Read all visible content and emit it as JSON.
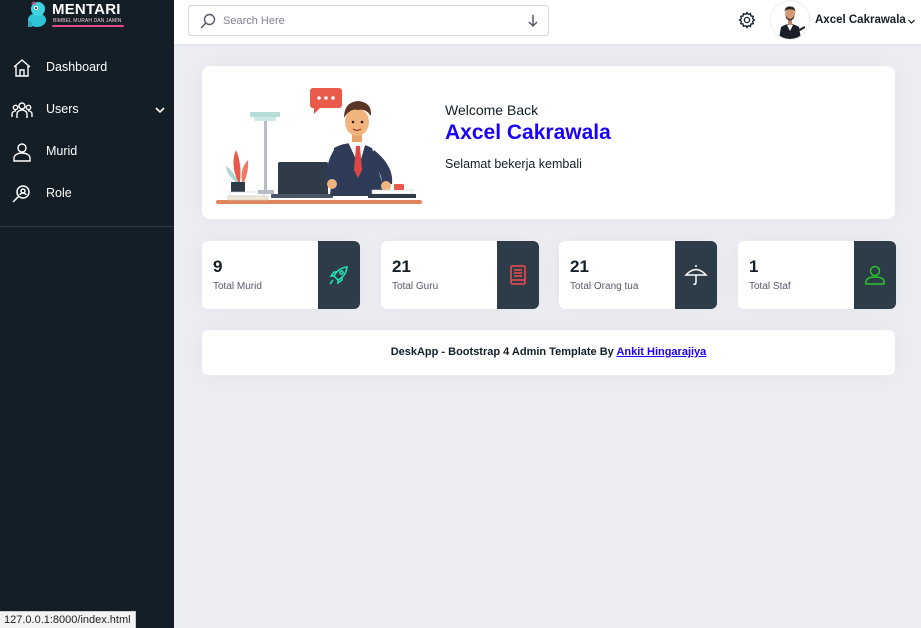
{
  "brand": {
    "name": "MENTARI",
    "tagline": "BIMBEL MURAH DAN JAMIN"
  },
  "sidebar": {
    "items": [
      {
        "label": "Dashboard",
        "icon": "house-icon"
      },
      {
        "label": "Users",
        "icon": "users-group-icon",
        "has_submenu": true
      },
      {
        "label": "Murid",
        "icon": "person-icon"
      },
      {
        "label": "Role",
        "icon": "key-search-icon"
      }
    ]
  },
  "header": {
    "search_placeholder": "Search Here",
    "user_name": "Axcel Cakrawala"
  },
  "welcome": {
    "greeting": "Welcome Back",
    "name": "Axcel Cakrawala",
    "subtitle": "Selamat bekerja kembali"
  },
  "stats": [
    {
      "value": "9",
      "label": "Total Murid",
      "icon": "rocket-icon",
      "color": "#1de9b6"
    },
    {
      "value": "21",
      "label": "Total Guru",
      "icon": "book-icon",
      "color": "#f44b4b"
    },
    {
      "value": "21",
      "label": "Total Orang tua",
      "icon": "umbrella-icon",
      "color": "#ffffff"
    },
    {
      "value": "1",
      "label": "Total Staf",
      "icon": "user-icon",
      "color": "#26c526"
    }
  ],
  "footer": {
    "text": "DeskApp - Bootstrap 4 Admin Template By",
    "link_text": "Ankit Hingarajiya"
  },
  "status_url": "127.0.0.1:8000/index.html",
  "colors": {
    "sidebar": "#131e27",
    "accent": "#1b00ff",
    "background": "#ecedf2",
    "icon_box": "#2e3c49"
  }
}
